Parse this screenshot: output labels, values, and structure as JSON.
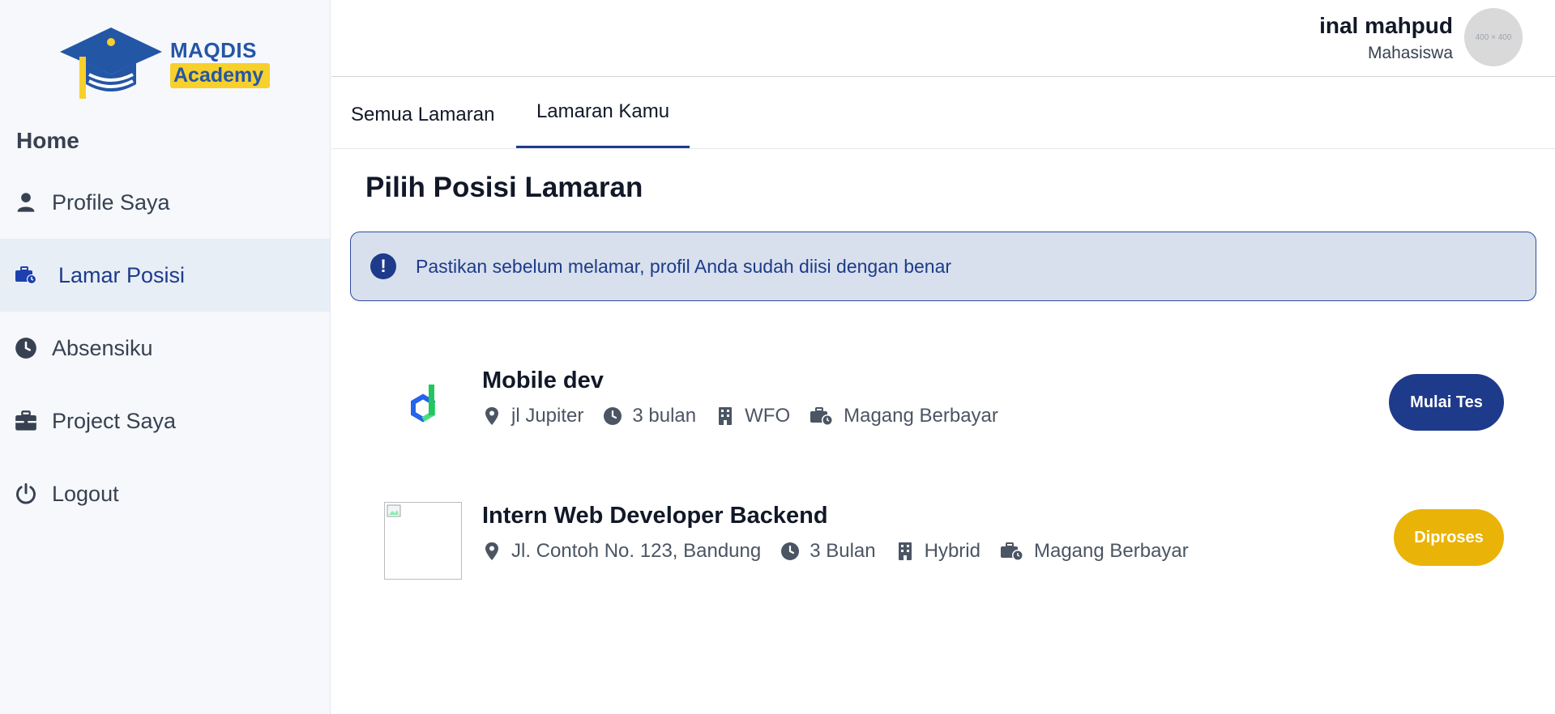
{
  "brand": {
    "name_top": "MAQDIS",
    "name_bottom": "Academy"
  },
  "sidebar": {
    "home_label": "Home",
    "items": [
      {
        "label": "Profile Saya",
        "icon": "user-icon",
        "active": false
      },
      {
        "label": "Lamar Posisi",
        "icon": "briefcase-clock-icon",
        "active": true
      },
      {
        "label": "Absensiku",
        "icon": "clock-icon",
        "active": false
      },
      {
        "label": "Project Saya",
        "icon": "briefcase-icon",
        "active": false
      },
      {
        "label": "Logout",
        "icon": "power-icon",
        "active": false
      }
    ]
  },
  "header": {
    "user_name": "inal mahpud",
    "user_role": "Mahasiswa",
    "avatar_placeholder": "400 × 400"
  },
  "tabs": [
    {
      "label": "Semua Lamaran",
      "active": false
    },
    {
      "label": "Lamaran Kamu",
      "active": true
    }
  ],
  "main": {
    "title": "Pilih Posisi Lamaran",
    "alert": {
      "icon": "exclamation-icon",
      "text": "Pastikan sebelum melamar, profil Anda sudah diisi dengan benar"
    },
    "jobs": [
      {
        "title": "Mobile dev",
        "location": "jl Jupiter",
        "duration": "3 bulan",
        "work_type": "WFO",
        "program": "Magang Berbayar",
        "action_label": "Mulai Tes",
        "action_color": "#1e3a8a"
      },
      {
        "title": "Intern Web Developer Backend",
        "location": "Jl. Contoh No. 123, Bandung",
        "duration": "3 Bulan",
        "work_type": "Hybrid",
        "program": "Magang Berbayar",
        "action_label": "Diproses",
        "action_color": "#eab308"
      }
    ]
  },
  "colors": {
    "primary": "#1e3a8a",
    "accent_yellow": "#eab308",
    "sidebar_bg": "#f6f8fb",
    "alert_bg": "#d7e0ec"
  }
}
